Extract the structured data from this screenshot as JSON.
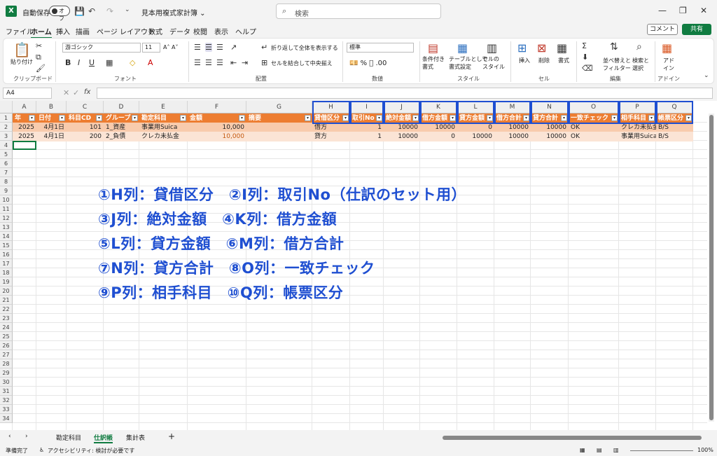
{
  "titlebar": {
    "app_icon": "excel-icon",
    "autosave_label": "自動保存",
    "autosave_state": "オフ",
    "doc_title": "見本用複式家計簿 ⌄",
    "search_placeholder": "検索"
  },
  "menu": {
    "items": [
      "ファイル",
      "ホーム",
      "挿入",
      "描画",
      "ページ レイアウト",
      "数式",
      "データ",
      "校閲",
      "表示",
      "ヘルプ"
    ],
    "active": "ホーム",
    "comment_label": "コメント",
    "share_label": "共有"
  },
  "ribbon": {
    "clipboard": {
      "paste": "貼り付け",
      "label": "クリップボード"
    },
    "font": {
      "name": "游ゴシック",
      "size": "11",
      "label": "フォント"
    },
    "align": {
      "wrap": "折り返して全体を表示する",
      "merge": "セルを結合して中央揃え",
      "label": "配置"
    },
    "number": {
      "format": "標準",
      "label": "数値"
    },
    "style": {
      "cond": "条件付き\n書式",
      "table": "テーブルとして\n書式設定",
      "cell": "セルの\nスタイル",
      "label": "スタイル"
    },
    "cells": {
      "insert": "挿入",
      "delete": "削除",
      "format": "書式",
      "label": "セル"
    },
    "edit": {
      "sort": "並べ替えと\nフィルター",
      "find": "検索と\n選択",
      "label": "編集"
    },
    "addin": {
      "addin": "アド\nイン",
      "label": "アドイン"
    }
  },
  "formulabar": {
    "namebox": "A4",
    "fx": "fx",
    "value": ""
  },
  "columns": [
    "A",
    "B",
    "C",
    "D",
    "E",
    "F",
    "G",
    "H",
    "I",
    "J",
    "K",
    "L",
    "M",
    "N",
    "O",
    "P",
    "Q"
  ],
  "header_row": [
    "年",
    "日付",
    "科目CD",
    "グループ",
    "勘定科目",
    "金額",
    "摘要",
    "貸借区分",
    "取引No",
    "絶対金額",
    "借方金額",
    "貸方金額",
    "借方合計",
    "貸方合計",
    "一致チェック",
    "相手科目",
    "帳票区分"
  ],
  "rows": [
    [
      "2025",
      "4月1日",
      "101",
      "1_資産",
      "事業用Suica",
      "10,000",
      "",
      "借方",
      "1",
      "10000",
      "10000",
      "0",
      "10000",
      "10000",
      "OK",
      "クレカ未払金",
      "B/S"
    ],
    [
      "2025",
      "4月1日",
      "200",
      "2_負債",
      "クレカ未払金",
      "10,000",
      "",
      "貸方",
      "1",
      "10000",
      "0",
      "10000",
      "10000",
      "10000",
      "OK",
      "事業用Suica",
      "B/S"
    ]
  ],
  "row_numbers": [
    "1",
    "2",
    "3",
    "4",
    "5",
    "6",
    "7",
    "8",
    "9",
    "10",
    "11",
    "12",
    "13",
    "14",
    "15",
    "16",
    "17",
    "18",
    "19",
    "20",
    "21",
    "22",
    "23",
    "24",
    "25",
    "26",
    "27",
    "28",
    "29",
    "30",
    "31",
    "32",
    "33",
    "34"
  ],
  "circled": [
    "①",
    "②",
    "③",
    "④",
    "⑤",
    "⑥",
    "⑦",
    "⑧",
    "⑨",
    "⑩"
  ],
  "notes": [
    "①H列：貸借区分　②I列：取引No（仕訳のセット用）",
    "③J列：絶対金額　④K列：借方金額",
    "⑤L列：貸方金額　⑥M列：借方合計",
    "⑦N列：貸方合計　⑧O列：一致チェック",
    "⑨P列：相手科目　⑩Q列：帳票区分"
  ],
  "sheets": {
    "tabs": [
      "勘定科目",
      "仕訳帳",
      "集計表"
    ],
    "active": "仕訳帳",
    "add": "+"
  },
  "status": {
    "ready": "準備完了",
    "accessibility": "アクセシビリティ: 検討が必要です",
    "zoom": "100%"
  },
  "colors": {
    "header_orange": "#ed7d31",
    "row_even": "#fbe4d5",
    "row_odd": "#f8cbad",
    "accent_blue": "#1f4fd1",
    "excel_green": "#107c41"
  }
}
